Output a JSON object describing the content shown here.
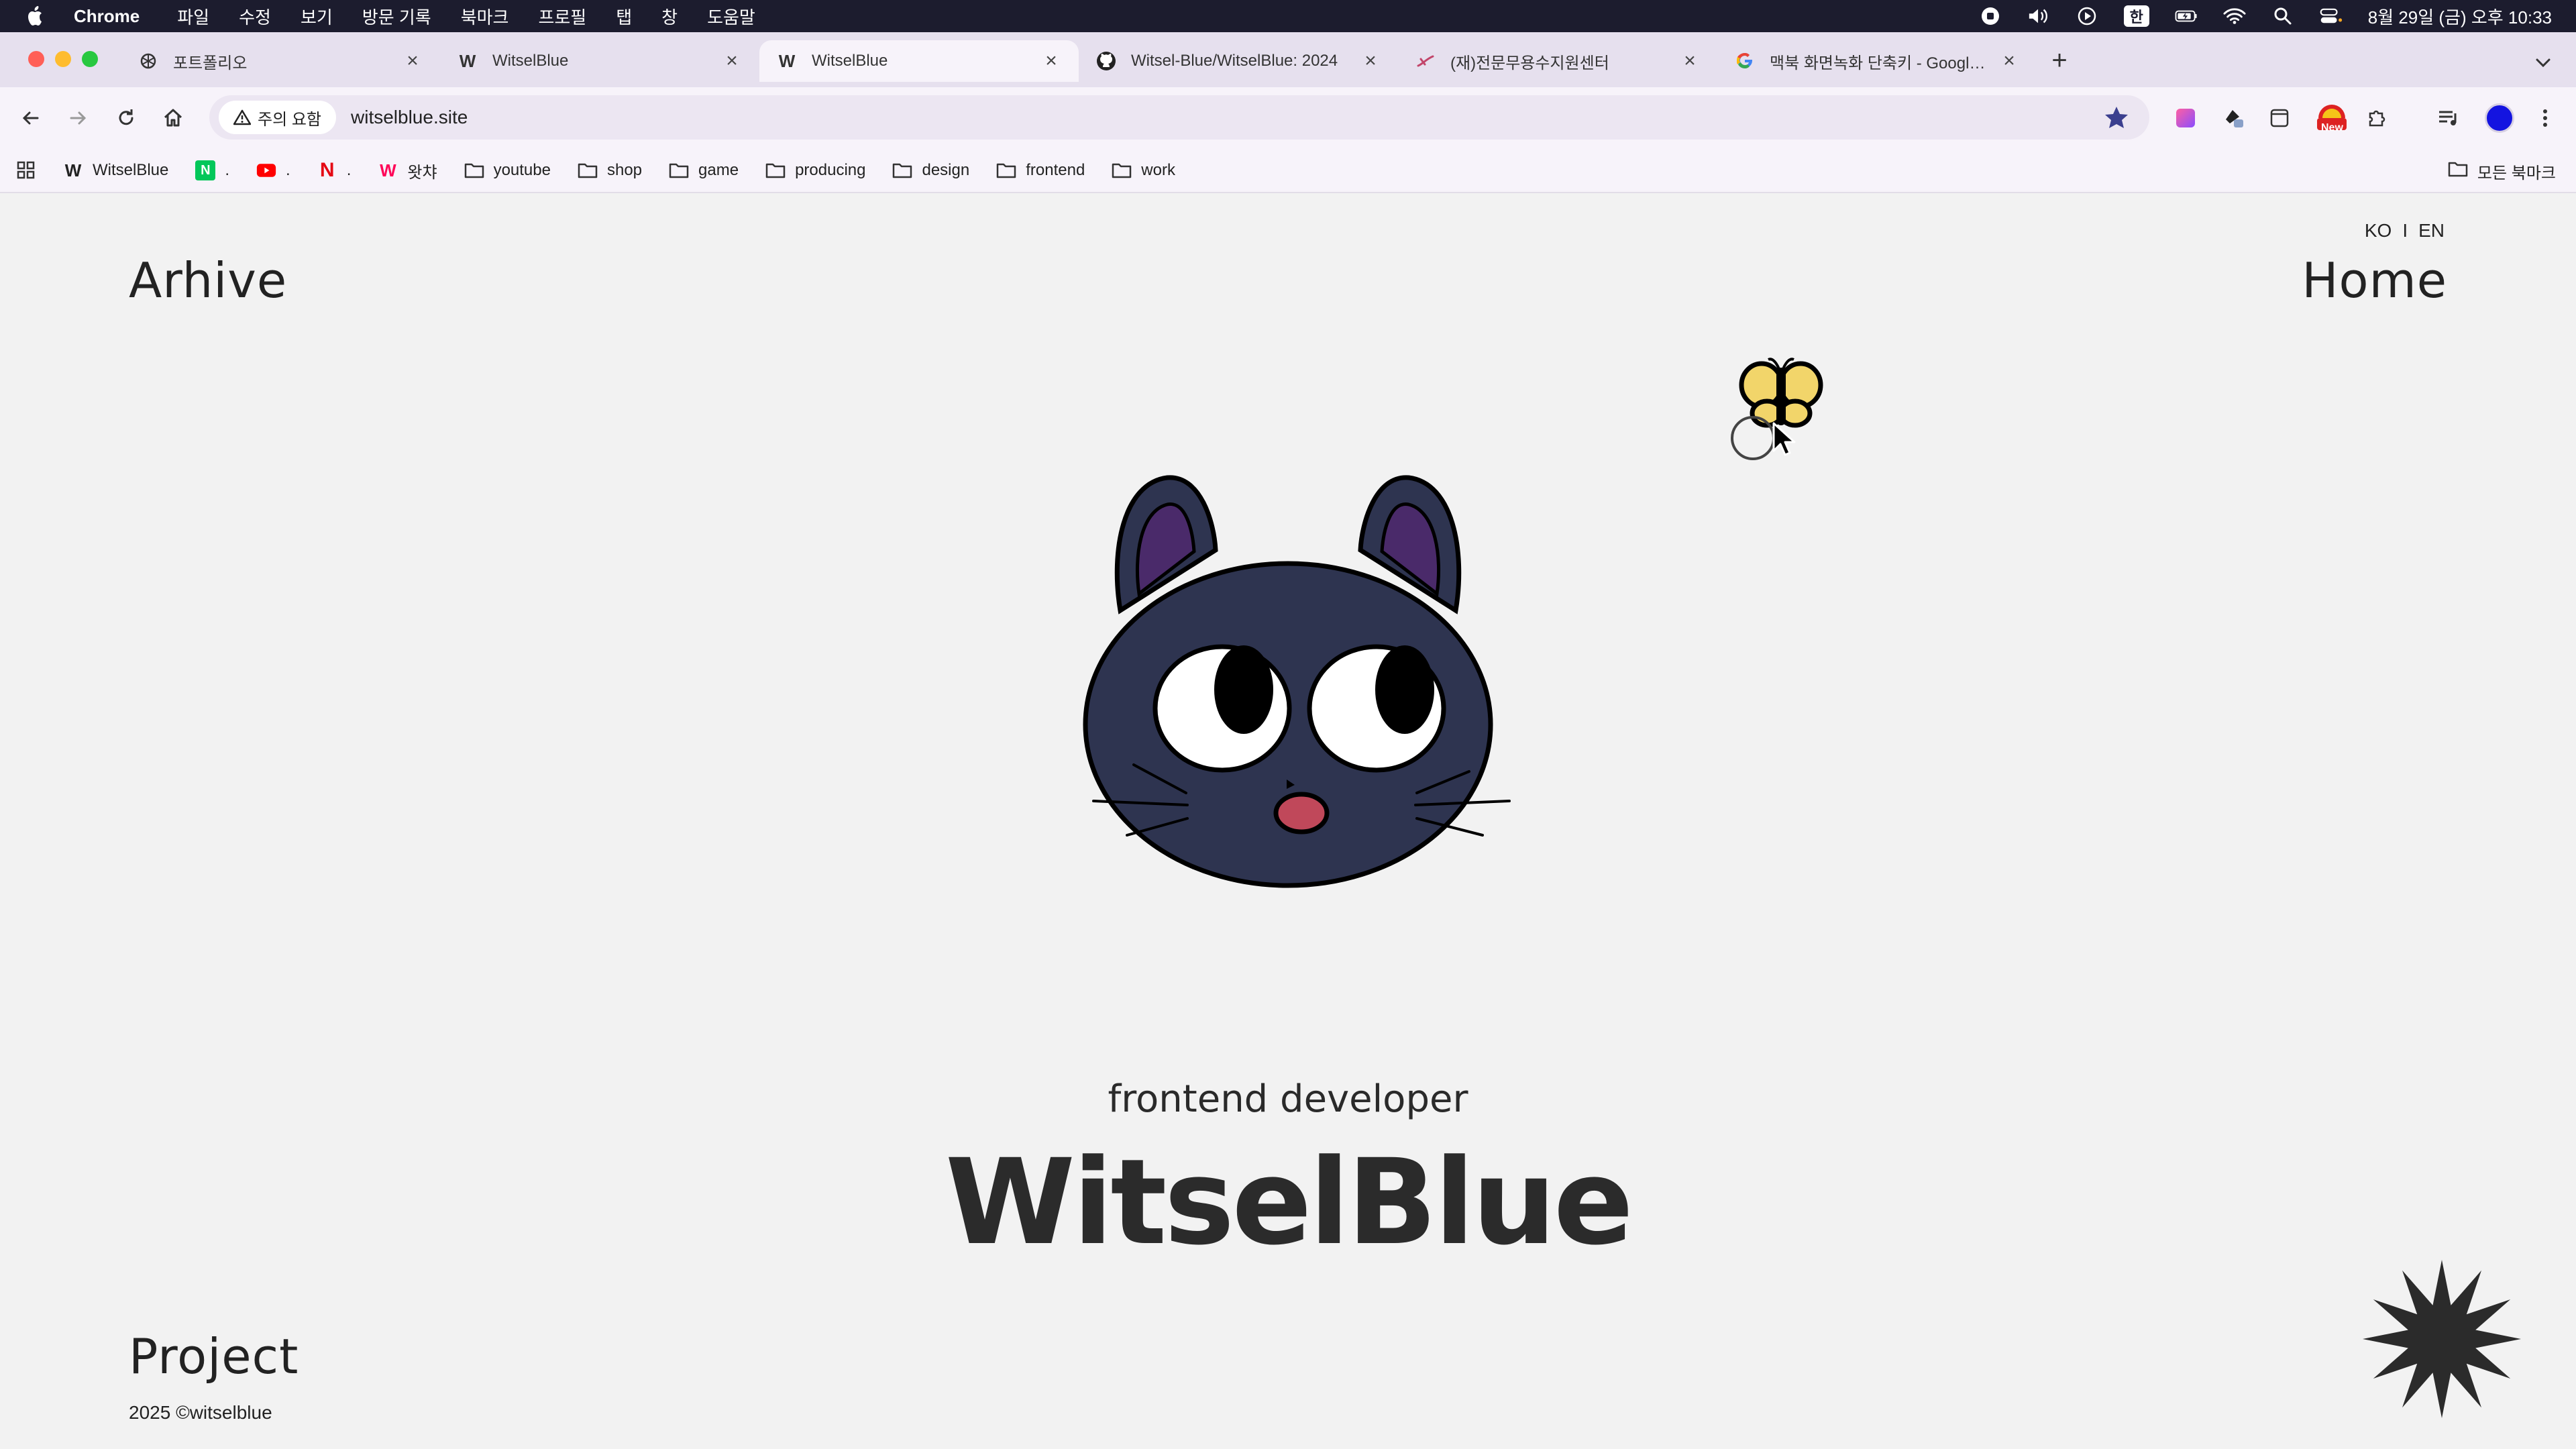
{
  "menubar": {
    "app": "Chrome",
    "items": [
      "파일",
      "수정",
      "보기",
      "방문 기록",
      "북마크",
      "프로필",
      "탭",
      "창",
      "도움말"
    ],
    "input_source": "한",
    "clock": "8월 29일 (금) 오후 10:33"
  },
  "tabs": [
    {
      "title": "포트폴리오",
      "favicon": "openai-icon",
      "active": false
    },
    {
      "title": "WitselBlue",
      "favicon": "W",
      "active": false
    },
    {
      "title": "WitselBlue",
      "favicon": "W",
      "active": true
    },
    {
      "title": "Witsel-Blue/WitselBlue: 2024",
      "favicon": "github-icon",
      "active": false
    },
    {
      "title": "(재)전문무용수지원센터",
      "favicon": "dance-icon",
      "active": false
    },
    {
      "title": "맥북 화면녹화 단축키 - Google 검",
      "favicon": "google-icon",
      "active": false
    }
  ],
  "toolbar": {
    "security_label": "주의 요함",
    "url": "witselblue.site",
    "ext_new_badge": "New"
  },
  "bookmarks": {
    "items": [
      {
        "label": "WitselBlue",
        "icon": "W"
      },
      {
        "label": ".",
        "icon": "N"
      },
      {
        "label": ".",
        "icon": "youtube-icon"
      },
      {
        "label": ".",
        "icon": "N"
      },
      {
        "label": "왓챠",
        "icon": "W"
      },
      {
        "label": "youtube",
        "icon": "folder-icon"
      },
      {
        "label": "shop",
        "icon": "folder-icon"
      },
      {
        "label": "game",
        "icon": "folder-icon"
      },
      {
        "label": "producing",
        "icon": "folder-icon"
      },
      {
        "label": "design",
        "icon": "folder-icon"
      },
      {
        "label": "frontend",
        "icon": "folder-icon"
      },
      {
        "label": "work",
        "icon": "folder-icon"
      }
    ],
    "all_bookmarks": "모든 북마크"
  },
  "site": {
    "lang_ko": "KO",
    "lang_sep": "I",
    "lang_en": "EN",
    "nav_archive": "Arhive",
    "nav_home": "Home",
    "nav_project": "Project",
    "subtitle": "frontend developer",
    "brand": "WitselBlue",
    "copyright": "2025 ©witselblue"
  },
  "colors": {
    "menubar": "#1c1c2e",
    "tabstrip": "#e6e0ee",
    "toolbar": "#f7f3fa",
    "page_bg": "#f2f2f2",
    "cat_body": "#2e3450",
    "cat_ear_inner": "#4a2a6a",
    "cat_mouth": "#c0485a",
    "butterfly": "#f2d56a"
  }
}
